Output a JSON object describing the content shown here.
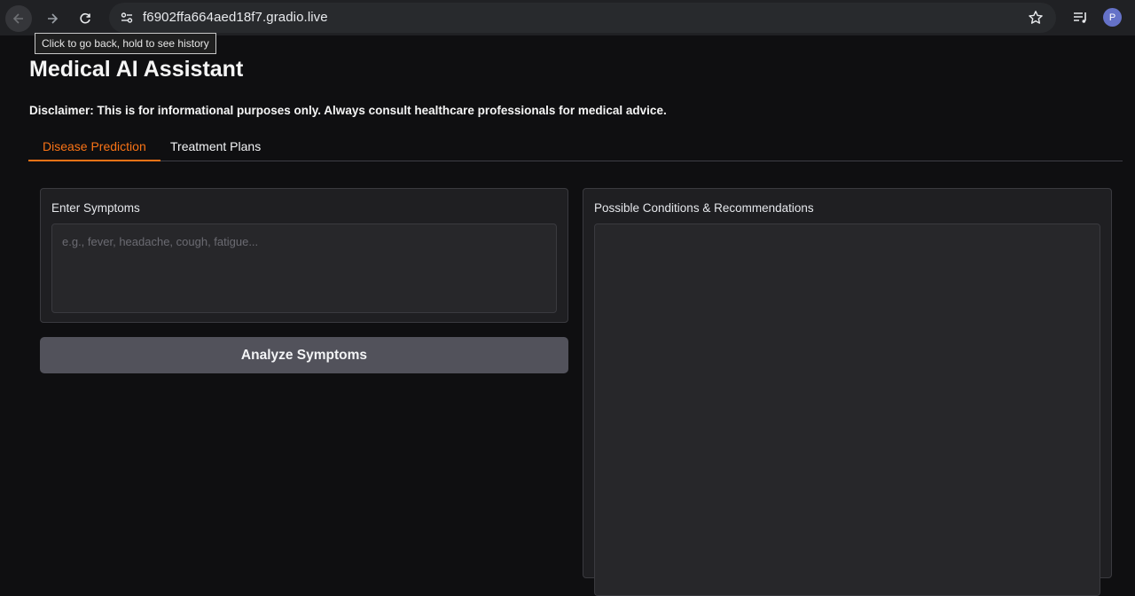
{
  "browser": {
    "url": "f6902ffa664aed18f7.gradio.live",
    "tooltip": "Click to go back, hold to see history",
    "profile_initial": "P",
    "icons": [
      "back-arrow-icon",
      "forward-arrow-icon",
      "reload-icon",
      "site-info-icon",
      "star-icon",
      "tab-search-icon"
    ]
  },
  "app": {
    "title": "Medical AI Assistant",
    "disclaimer": "Disclaimer: This is for informational purposes only. Always consult healthcare professionals for medical advice.",
    "tabs": [
      {
        "label": "Disease Prediction",
        "active": true
      },
      {
        "label": "Treatment Plans",
        "active": false
      }
    ],
    "accent_color": "#f97316"
  },
  "symptoms": {
    "label": "Enter Symptoms",
    "placeholder": "e.g., fever, headache, cough, fatigue...",
    "value": ""
  },
  "analyze_button": {
    "label": "Analyze Symptoms"
  },
  "results": {
    "label": "Possible Conditions & Recommendations",
    "value": ""
  }
}
